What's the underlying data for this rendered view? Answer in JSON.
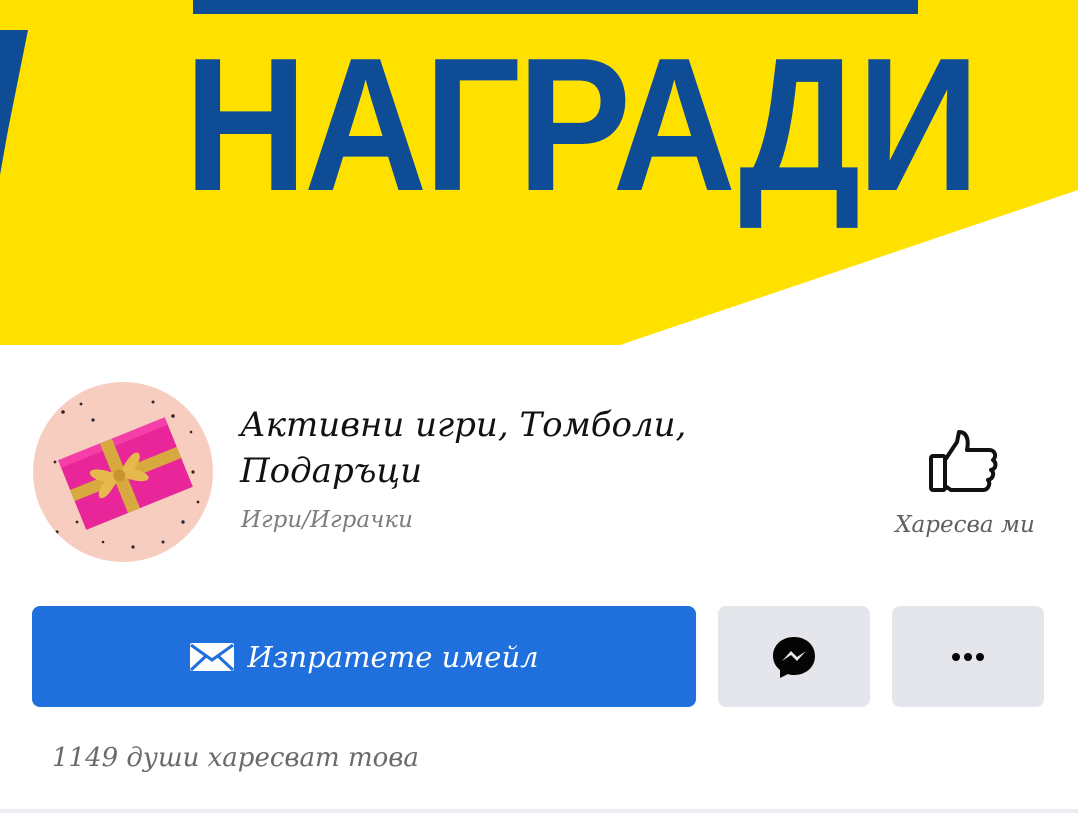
{
  "cover": {
    "title": "НАГРАДИ",
    "colors": {
      "yellow": "#ffe100",
      "blue": "#0e4c96"
    }
  },
  "profile": {
    "name": "Активни игри, Томболи, Подаръци",
    "category": "Игри/Играчки",
    "avatar_icon": "gift-box-avatar"
  },
  "actions": {
    "like_label": "Харесва ми",
    "email_label": "Изпратете имейл",
    "messenger_icon": "messenger-icon",
    "more_icon": "more-dots-icon",
    "primary_color": "#1f70dd"
  },
  "stats": {
    "likes_text": "1149 души харесват това"
  }
}
